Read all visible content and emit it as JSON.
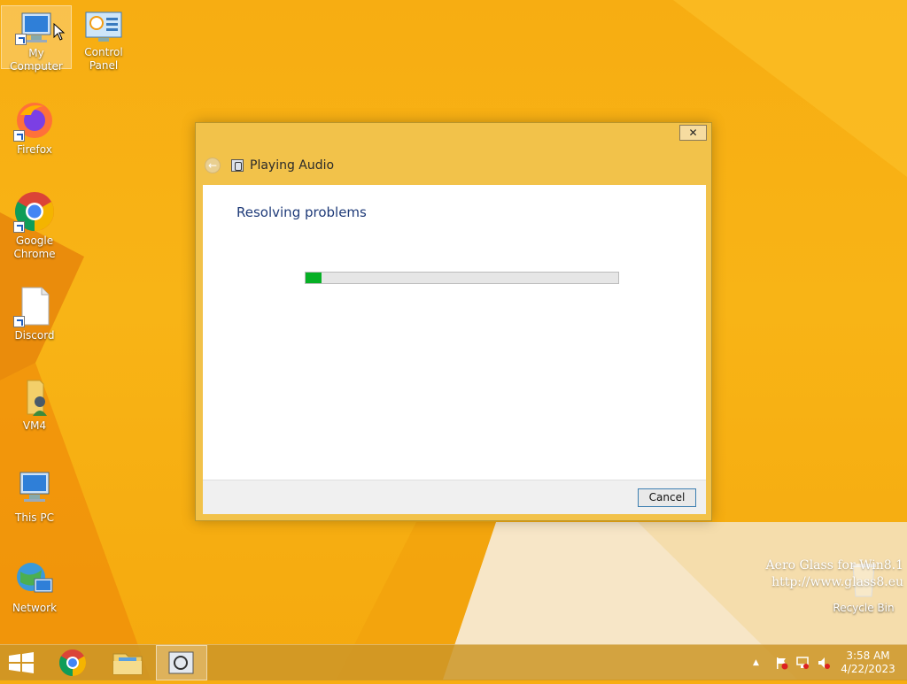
{
  "desktop": {
    "icons": [
      {
        "label": "My Computer"
      },
      {
        "label": "Control Panel"
      },
      {
        "label": "Firefox"
      },
      {
        "label": "Google Chrome"
      },
      {
        "label": "Discord"
      },
      {
        "label": "VM4"
      },
      {
        "label": "This PC"
      },
      {
        "label": "Network"
      },
      {
        "label": "Recycle Bin"
      }
    ]
  },
  "dialog": {
    "title": "Playing Audio",
    "close_label": "✕",
    "back_label": "←",
    "heading": "Resolving problems",
    "progress_fraction": 0.05,
    "cancel_label": "Cancel"
  },
  "watermark": {
    "line1": "Aero Glass for Win8.1",
    "line2": "http://www.glass8.eu"
  },
  "taskbar": {
    "time": "3:58 AM",
    "date": "4/22/2023",
    "tray_expand": "▲"
  },
  "colors": {
    "accent": "#f8b416",
    "progress": "#06b025",
    "heading": "#1e3a78"
  }
}
